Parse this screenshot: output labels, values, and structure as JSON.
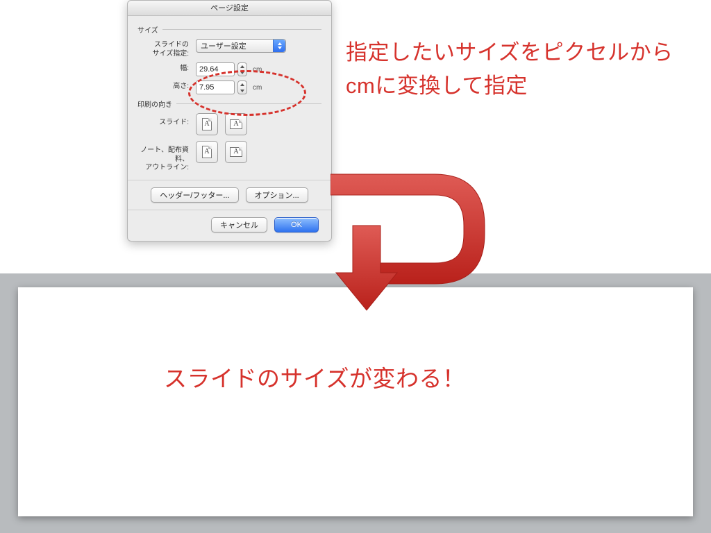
{
  "dialog": {
    "title": "ページ設定",
    "size_section": "サイズ",
    "preset_label": "スライドの\nサイズ指定:",
    "preset_value": "ユーザー設定",
    "width_label": "幅:",
    "width_value": "29.64",
    "height_label": "高さ:",
    "height_value": "7.95",
    "unit": "cm",
    "orient_section": "印刷の向き",
    "slide_orient_label": "スライド:",
    "notes_orient_label": "ノート、配布資料、\nアウトライン:",
    "header_footer_btn": "ヘッダー/フッター...",
    "options_btn": "オプション...",
    "cancel_btn": "キャンセル",
    "ok_btn": "OK"
  },
  "annotation": {
    "top": "指定したいサイズをピクセルからcmに変換して指定",
    "bottom": "スライドのサイズが変わる！"
  },
  "colors": {
    "accent_red": "#d6322c",
    "aqua_blue": "#2f72ef"
  }
}
